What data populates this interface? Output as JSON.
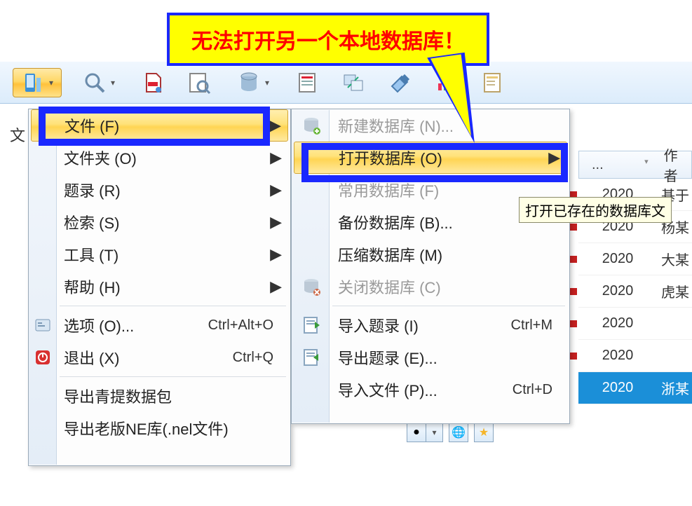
{
  "annotation": {
    "text": "无法打开另一个本地数据库！"
  },
  "toolbar": {
    "buttons": [
      {
        "name": "app-button",
        "dd": true
      },
      {
        "name": "search-view-button",
        "dd": true
      },
      {
        "name": "pdf-button"
      },
      {
        "name": "preview-button"
      },
      {
        "name": "database-button",
        "dd": true
      },
      {
        "name": "list-button"
      },
      {
        "name": "sync-button"
      },
      {
        "name": "eraser-button"
      },
      {
        "name": "chart-button"
      },
      {
        "name": "report-button"
      }
    ]
  },
  "left_label": "文",
  "main_menu": {
    "items": [
      {
        "label": "文件 (F)",
        "u": "F",
        "arrow": true,
        "hover": true
      },
      {
        "label": "文件夹 (O)",
        "u": "O",
        "arrow": true
      },
      {
        "label": "题录 (R)",
        "u": "R",
        "arrow": true
      },
      {
        "label": "检索 (S)",
        "u": "S",
        "arrow": true
      },
      {
        "label": "工具 (T)",
        "u": "T",
        "arrow": true
      },
      {
        "label": "帮助 (H)",
        "u": "H",
        "arrow": true
      }
    ],
    "items2": [
      {
        "label": "选项 (O)...",
        "u": "O",
        "sc": "Ctrl+Alt+O",
        "icon": "options-icon"
      },
      {
        "label": "退出 (X)",
        "u": "X",
        "sc": "Ctrl+Q",
        "icon": "power-icon"
      }
    ],
    "items3": [
      {
        "label": "导出青提数据包"
      },
      {
        "label": "导出老版NE库(.nel文件)"
      }
    ]
  },
  "sub_menu": {
    "items": [
      {
        "label": "新建数据库 (N)...",
        "u": "N",
        "disabled": true,
        "icon": "db-new-icon"
      },
      {
        "label": "打开数据库 (O)",
        "u": "O",
        "arrow": true,
        "hover": true
      },
      {
        "label": "常用数据库 (F)",
        "u": "F",
        "disabled": true
      },
      {
        "label": "备份数据库 (B)...",
        "u": "B"
      },
      {
        "label": "压缩数据库 (M)",
        "u": "M"
      },
      {
        "label": "关闭数据库 (C)",
        "u": "C",
        "disabled": true,
        "icon": "db-close-icon"
      }
    ],
    "items2": [
      {
        "label": "导入题录 (I)",
        "u": "I",
        "sc": "Ctrl+M",
        "icon": "import-icon"
      },
      {
        "label": "导出题录 (E)...",
        "u": "E",
        "icon": "export-icon"
      },
      {
        "label": "导入文件 (P)...",
        "u": "P",
        "sc": "Ctrl+D"
      }
    ]
  },
  "tooltip": {
    "text": "打开已存在的数据库文"
  },
  "table": {
    "col1": "...",
    "col2": "作者",
    "rows": [
      {
        "year": "2020",
        "author": "基于"
      },
      {
        "year": "2020",
        "author": "杨某"
      },
      {
        "year": "2020",
        "author": "大某"
      },
      {
        "year": "2020",
        "author": "虎某"
      },
      {
        "year": "2020",
        "author": ""
      },
      {
        "year": "2020",
        "author": ""
      },
      {
        "year": "2020",
        "author": "浙某",
        "selected": true
      }
    ]
  }
}
